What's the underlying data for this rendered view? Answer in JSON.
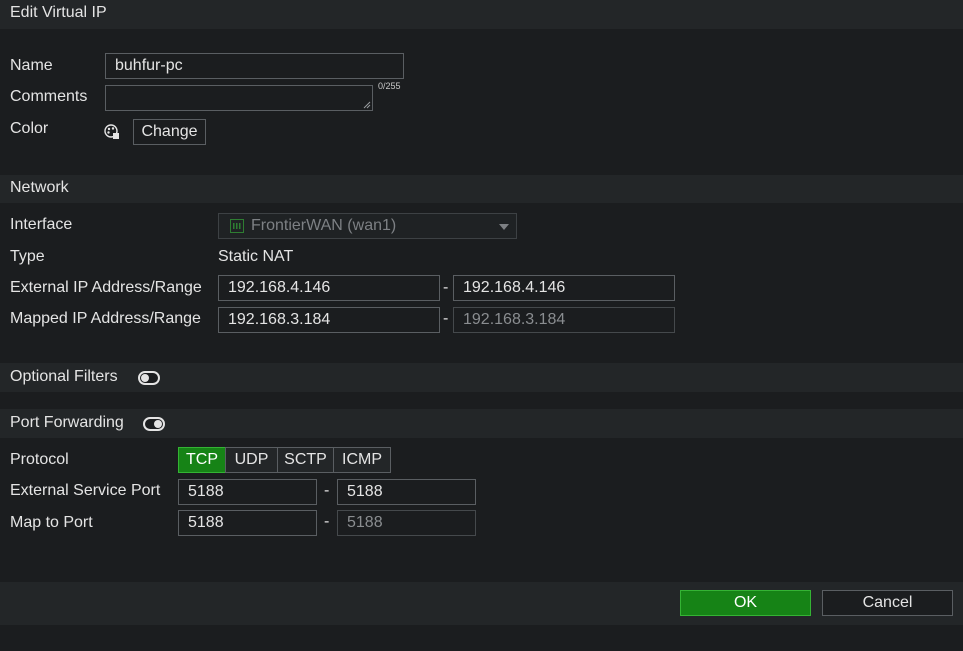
{
  "dialog": {
    "title": "Edit Virtual IP"
  },
  "general": {
    "name_label": "Name",
    "name_value": "buhfur-pc",
    "comments_label": "Comments",
    "comments_value": "",
    "comments_counter": "0/255",
    "color_label": "Color",
    "change_label": "Change"
  },
  "network": {
    "title": "Network",
    "interface_label": "Interface",
    "interface_value": "FrontierWAN (wan1)",
    "type_label": "Type",
    "type_value": "Static NAT",
    "external_label": "External IP Address/Range",
    "external_start": "192.168.4.146",
    "external_end": "192.168.4.146",
    "mapped_label": "Mapped IP Address/Range",
    "mapped_start": "192.168.3.184",
    "mapped_end": "192.168.3.184",
    "range_separator": "-"
  },
  "optional_filters": {
    "label": "Optional Filters",
    "enabled": false
  },
  "port_forwarding": {
    "label": "Port Forwarding",
    "enabled": true,
    "protocol_label": "Protocol",
    "protocols": [
      "TCP",
      "UDP",
      "SCTP",
      "ICMP"
    ],
    "selected_protocol": "TCP",
    "external_port_label": "External Service Port",
    "external_port_start": "5188",
    "external_port_end": "5188",
    "map_port_label": "Map to Port",
    "map_port_start": "5188",
    "map_port_end": "5188"
  },
  "footer": {
    "ok_label": "OK",
    "cancel_label": "Cancel"
  },
  "colors": {
    "accent": "#168316",
    "accent_border": "#34b334",
    "background": "#1b1d1f",
    "band": "#232628"
  },
  "icons": {
    "color_picker": "color-palette-icon",
    "interface": "network-port-icon",
    "dropdown": "chevron-down-icon"
  }
}
